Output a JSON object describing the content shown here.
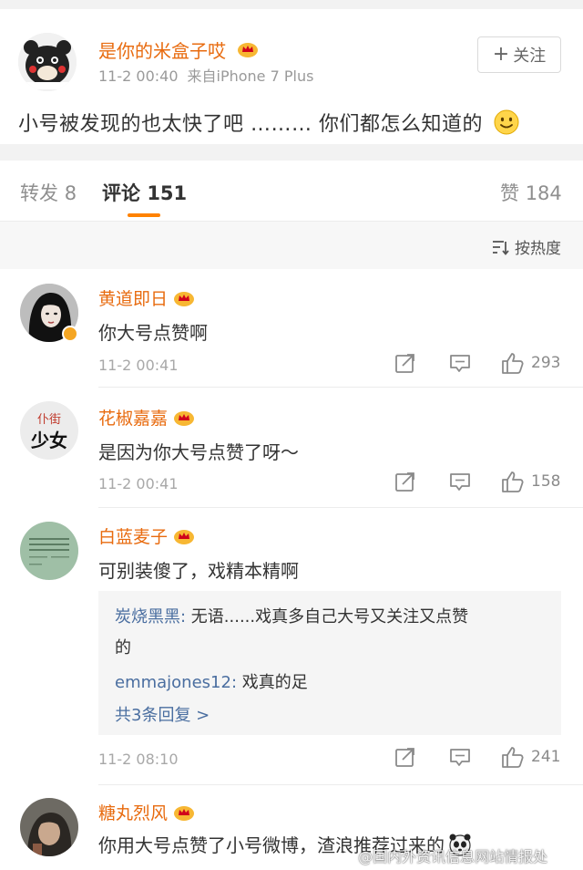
{
  "post": {
    "author": "是你的米盒子哎",
    "time": "11-2 00:40",
    "source": "来自iPhone 7 Plus",
    "follow_label": "关注",
    "text": "小号被发现的也太快了吧 ……… 你们都怎么知道的"
  },
  "tabs": {
    "reposts_label": "转发",
    "reposts_count": "8",
    "comments_label": "评论",
    "comments_count": "151",
    "likes_label": "赞",
    "likes_count": "184"
  },
  "sort": {
    "label": "按热度"
  },
  "comments": [
    {
      "name": "黄道即日",
      "text": "你大号点赞啊",
      "time": "11-2 00:41",
      "likes": "293"
    },
    {
      "name": "花椒嘉嘉",
      "avatar_text_top": "仆街",
      "avatar_text_bottom": "少女",
      "text": "是因为你大号点赞了呀～",
      "time": "11-2 00:41",
      "likes": "158"
    },
    {
      "name": "白蓝麦子",
      "text": "可别装傻了，戏精本精啊",
      "time": "11-2 08:10",
      "likes": "241",
      "replies": [
        {
          "user": "炭烧黑黑:",
          "text": " 无语......戏真多自己大号又关注又点赞",
          "text_cont": "的"
        },
        {
          "user": "emmajones12:",
          "text": " 戏真的足"
        }
      ],
      "more_replies": "共3条回复 >"
    },
    {
      "name": "糖丸烈风",
      "text": "你用大号点赞了小号微博，渣浪推荐过来的"
    }
  ],
  "watermark": "@国内外资讯信息网站情报处",
  "colors": {
    "accent": "#ff8200",
    "username": "#e86b0f",
    "link": "#4a6ea0"
  }
}
